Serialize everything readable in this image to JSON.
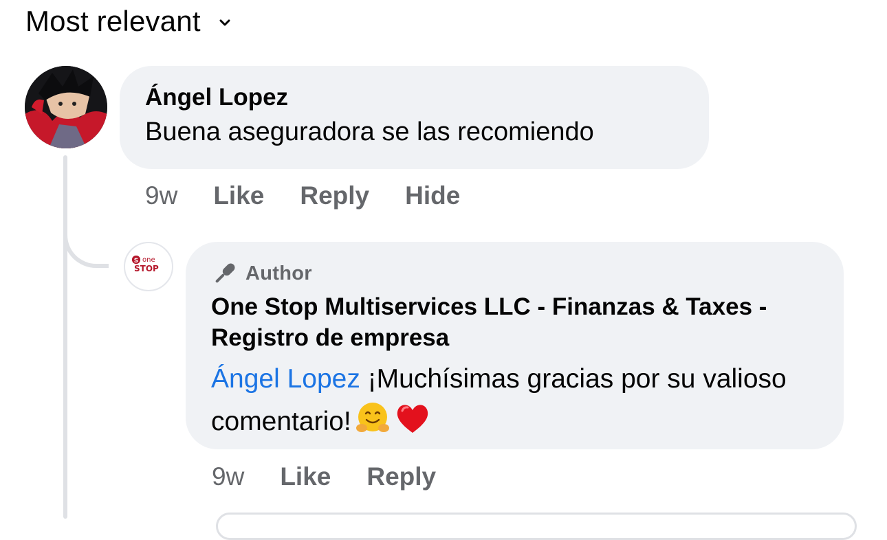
{
  "sort": {
    "label": "Most relevant"
  },
  "comment": {
    "author": "Ángel Lopez",
    "text": "Buena aseguradora se las recomiendo",
    "time": "9w",
    "actions": {
      "like": "Like",
      "reply": "Reply",
      "hide": "Hide"
    }
  },
  "reply": {
    "badge": "Author",
    "author": "One Stop Multiservices LLC - Finanzas & Taxes - Registro de empresa",
    "mention": "Ángel Lopez",
    "text": " ¡Muchísimas gracias por su valioso comentario!",
    "emojis": [
      "hugging-face",
      "red-heart"
    ],
    "time": "9w",
    "actions": {
      "like": "Like",
      "reply": "Reply"
    },
    "avatar_logo": {
      "badge": "S",
      "top": "one",
      "bottom": "STOP"
    }
  },
  "colors": {
    "mention": "#1b74e4",
    "secondary_text": "#65676b",
    "bubble": "#f0f2f5",
    "logo_red": "#b5172b"
  }
}
